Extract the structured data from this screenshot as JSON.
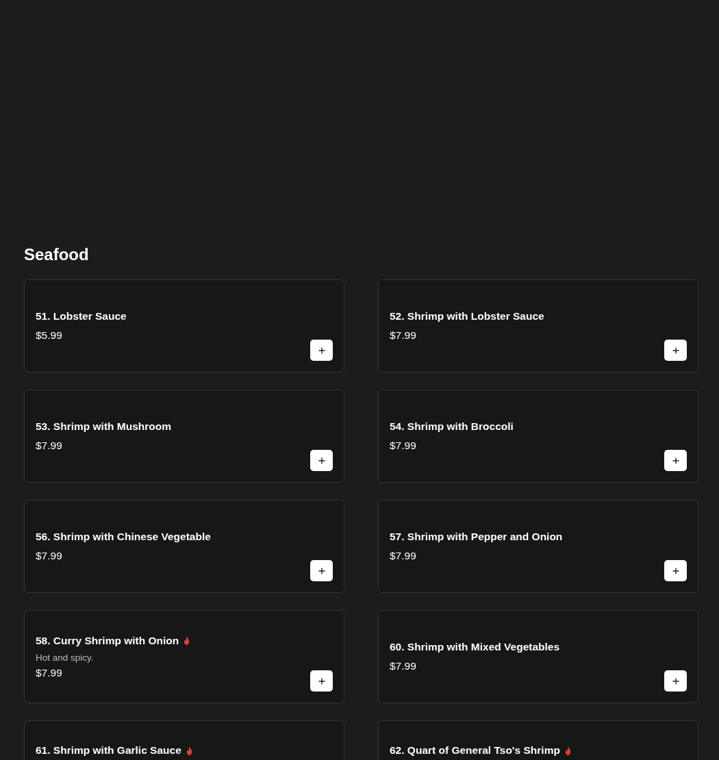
{
  "section": {
    "title": "Seafood"
  },
  "items": [
    {
      "name": "51. Lobster Sauce",
      "price": "$5.99",
      "spicy": false
    },
    {
      "name": "52. Shrimp with Lobster Sauce",
      "price": "$7.99",
      "spicy": false
    },
    {
      "name": "53. Shrimp with Mushroom",
      "price": "$7.99",
      "spicy": false
    },
    {
      "name": "54. Shrimp with Broccoli",
      "price": "$7.99",
      "spicy": false
    },
    {
      "name": "56. Shrimp with Chinese Vegetable",
      "price": "$7.99",
      "spicy": false
    },
    {
      "name": "57. Shrimp with Pepper and Onion",
      "price": "$7.99",
      "spicy": false
    },
    {
      "name": "58. Curry Shrimp with Onion",
      "description": "Hot and spicy.",
      "price": "$7.99",
      "spicy": true
    },
    {
      "name": "60. Shrimp with Mixed Vegetables",
      "price": "$7.99",
      "spicy": false
    },
    {
      "name": "61. Shrimp with Garlic Sauce",
      "spicy": true
    },
    {
      "name": "62. Quart of General Tso's Shrimp",
      "spicy": true
    }
  ]
}
